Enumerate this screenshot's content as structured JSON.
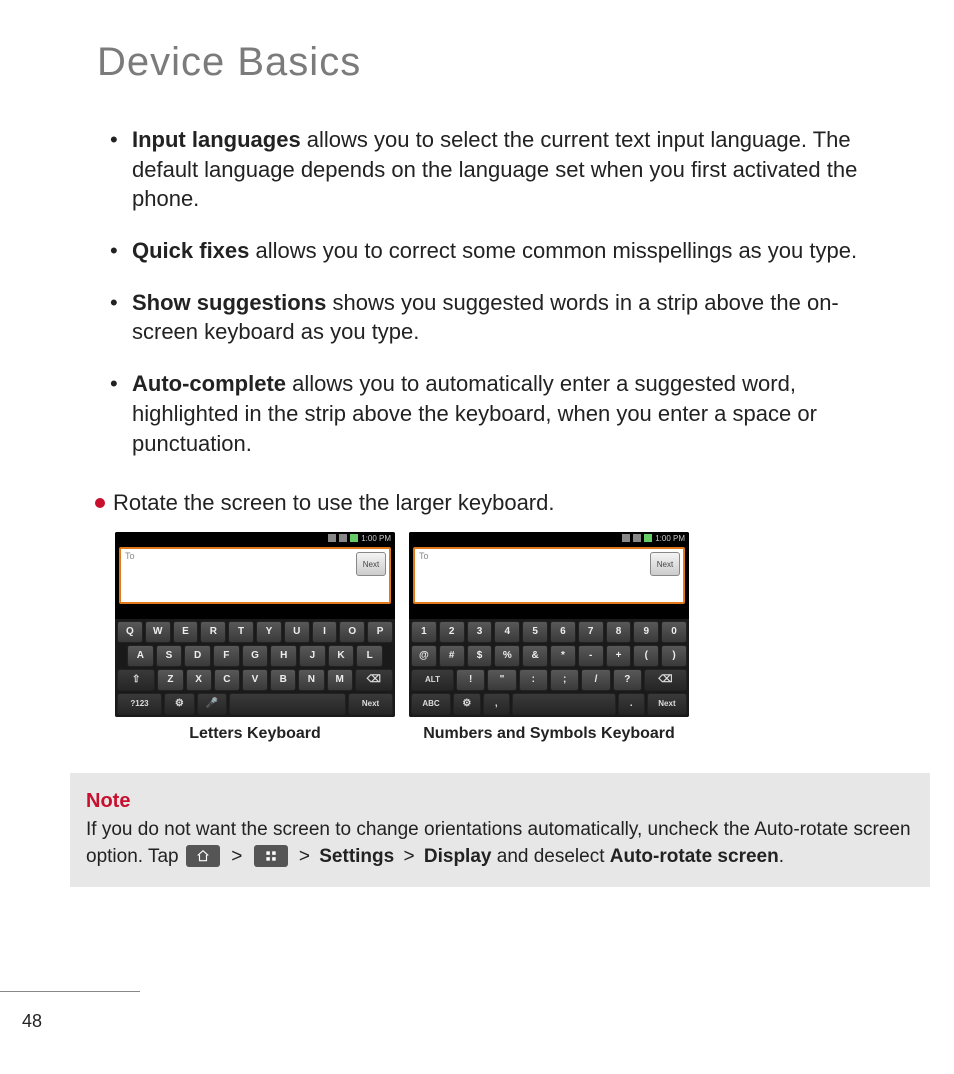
{
  "title": "Device Basics",
  "features": [
    {
      "label": "Input languages",
      "desc": " allows you to select the current text input language. The default language depends on the language set when you first activated the phone."
    },
    {
      "label": "Quick fixes",
      "desc": " allows you to correct some common misspellings as you type."
    },
    {
      "label": "Show suggestions",
      "desc": " shows you suggested words in a strip above the on-screen keyboard as you type."
    },
    {
      "label": "Auto-complete",
      "desc": " allows you to automatically enter a suggested word, highlighted in the strip above the keyboard, when you enter a space or punctuation."
    }
  ],
  "rotate_line": "Rotate the screen to use the larger keyboard.",
  "screenshots": {
    "status_time": "1:00 PM",
    "input_label": "To",
    "next_label": "Next",
    "letters": {
      "row1": [
        "Q",
        "W",
        "E",
        "R",
        "T",
        "Y",
        "U",
        "I",
        "O",
        "P"
      ],
      "row2": [
        "A",
        "S",
        "D",
        "F",
        "G",
        "H",
        "J",
        "K",
        "L"
      ],
      "row3_shift": "⇧",
      "row3": [
        "Z",
        "X",
        "C",
        "V",
        "B",
        "N",
        "M"
      ],
      "row3_del": "⌫",
      "row4_sym": "?123",
      "row4_gear": "⚙",
      "row4_mic": "🎤",
      "row4_next": "Next",
      "caption": "Letters Keyboard"
    },
    "numbers": {
      "row1": [
        "1",
        "2",
        "3",
        "4",
        "5",
        "6",
        "7",
        "8",
        "9",
        "0"
      ],
      "row2": [
        "@",
        "#",
        "$",
        "%",
        "&",
        "*",
        "-",
        "+",
        "(",
        ")"
      ],
      "row3_alt": "ALT",
      "row3": [
        "!",
        "\"",
        ":",
        ";",
        "/",
        "?"
      ],
      "row3_del": "⌫",
      "row4_abc": "ABC",
      "row4_gear": "⚙",
      "row4_comma": ",",
      "row4_dot": ".",
      "row4_next": "Next",
      "caption": "Numbers and Symbols Keyboard"
    }
  },
  "note": {
    "heading": "Note",
    "body_pre": "If you do not want the screen to change orientations automatically, uncheck the Auto-rotate screen option. Tap ",
    "path_settings": "Settings",
    "path_display": "Display",
    "body_mid": " and deselect ",
    "path_autorotate": "Auto-rotate screen",
    "body_post": "."
  },
  "page_number": "48",
  "gt": ">"
}
